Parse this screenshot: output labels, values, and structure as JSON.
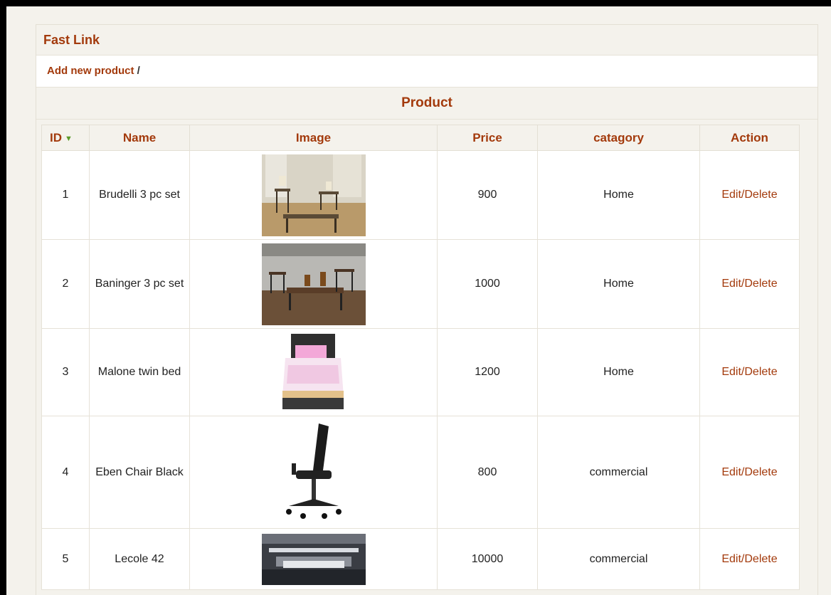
{
  "fast_link": {
    "title": "Fast Link",
    "add_link": "Add new product",
    "separator": "/"
  },
  "product": {
    "heading": "Product",
    "columns": [
      "ID",
      "Name",
      "Image",
      "Price",
      "catagory",
      "Action"
    ],
    "sort_icon": "sort-down-arrow-icon",
    "rows": [
      {
        "id": "1",
        "name": "Brudelli 3 pc set",
        "image": "living-room-tables-image",
        "price": "900",
        "category": "Home",
        "action": "Edit/Delete"
      },
      {
        "id": "2",
        "name": "Baninger 3 pc set",
        "image": "living-room-tables-image",
        "price": "1000",
        "category": "Home",
        "action": "Edit/Delete"
      },
      {
        "id": "3",
        "name": "Malone twin bed",
        "image": "twin-bed-image",
        "price": "1200",
        "category": "Home",
        "action": "Edit/Delete"
      },
      {
        "id": "4",
        "name": "Eben Chair Black",
        "image": "office-chair-image",
        "price": "800",
        "category": "commercial",
        "action": "Edit/Delete"
      },
      {
        "id": "5",
        "name": "Lecole 42",
        "image": "office-interior-image",
        "price": "10000",
        "category": "commercial",
        "action": "Edit/Delete"
      }
    ]
  },
  "colors": {
    "accent": "#a33a0c",
    "panel_bg": "#f4f2ec",
    "border": "#e3dfd4"
  }
}
